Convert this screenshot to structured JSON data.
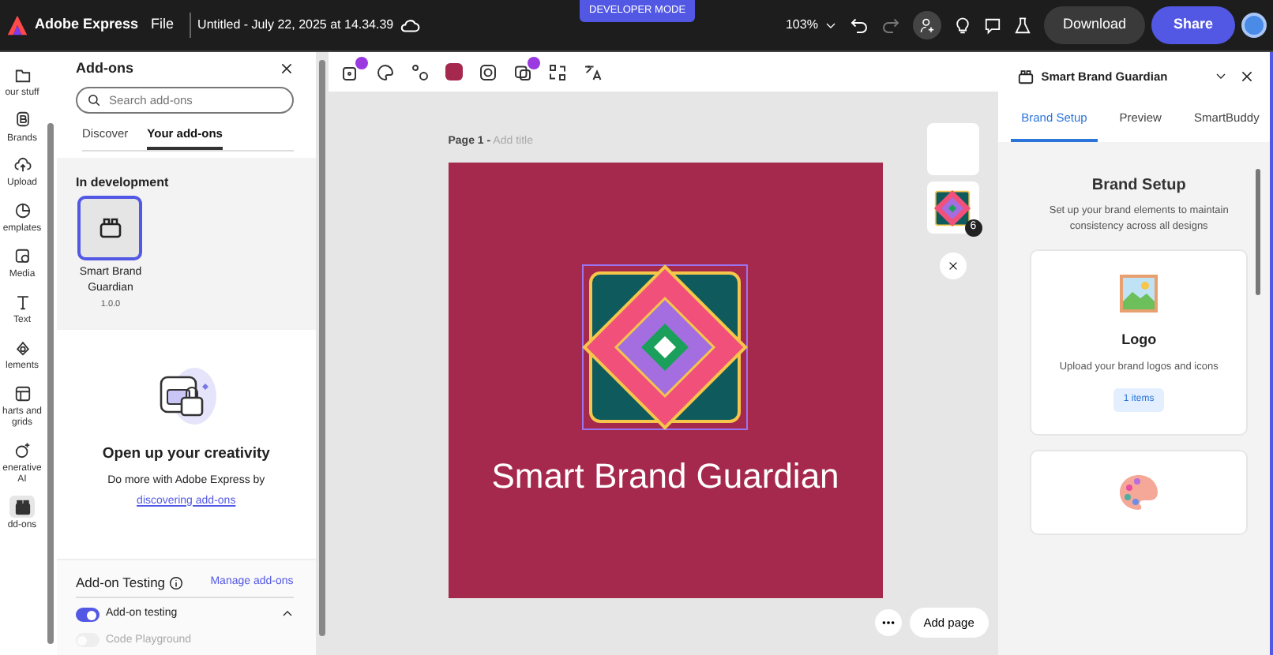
{
  "top_bar": {
    "app_name": "Adobe Express",
    "menu": "File",
    "document_title": "Untitled - July 22, 2025 at 14.34.39",
    "mode_badge": "DEVELOPER MODE",
    "zoom": "103%",
    "download": "Download",
    "share": "Share"
  },
  "left_rail": [
    {
      "label": "our stuff",
      "selected": false
    },
    {
      "label": "Brands",
      "selected": false
    },
    {
      "label": "Upload",
      "selected": false
    },
    {
      "label": "emplates",
      "selected": false
    },
    {
      "label": "Media",
      "selected": false
    },
    {
      "label": "Text",
      "selected": false
    },
    {
      "label": "lements",
      "selected": false
    },
    {
      "label": "harts and grids",
      "selected": false
    },
    {
      "label": "enerative AI",
      "selected": false
    },
    {
      "label": "dd-ons",
      "selected": true
    }
  ],
  "addons_panel": {
    "title": "Add-ons",
    "search": {
      "placeholder": "Search add-ons"
    },
    "tabs": [
      {
        "label": "Discover",
        "selected": false
      },
      {
        "label": "Your add-ons",
        "selected": true
      }
    ],
    "section": "In development",
    "addons": [
      {
        "name": "Smart Brand Guardian",
        "version": "1.0.0",
        "selected": true
      }
    ],
    "empty_state": {
      "heading": "Open up your creativity",
      "text": "Do more with Adobe Express by",
      "link": "discovering add-ons"
    },
    "testing": {
      "title": "Add-on Testing",
      "manage_link": "Manage add-ons",
      "toggles": [
        {
          "label": "Add-on testing",
          "on": true,
          "disabled": false
        },
        {
          "label": "Code Playground",
          "on": false,
          "disabled": true
        }
      ]
    }
  },
  "canvas": {
    "page_label": "Page 1 -",
    "title_placeholder": "Add title",
    "design_text": "Smart Brand Guardian",
    "thumbnail_badge": "6",
    "add_page": "Add page"
  },
  "right_panel": {
    "title": "Smart Brand Guardian",
    "tabs": [
      {
        "label": "Brand Setup",
        "selected": true
      },
      {
        "label": "Preview",
        "selected": false
      },
      {
        "label": "SmartBuddy",
        "selected": false
      }
    ],
    "heading": "Brand Setup",
    "description": "Set up your brand elements to maintain consistency across all designs",
    "cards": [
      {
        "kind": "logo",
        "title": "Logo",
        "description": "Upload your brand logos and icons",
        "badge": "1 items"
      },
      {
        "kind": "palette"
      }
    ]
  }
}
